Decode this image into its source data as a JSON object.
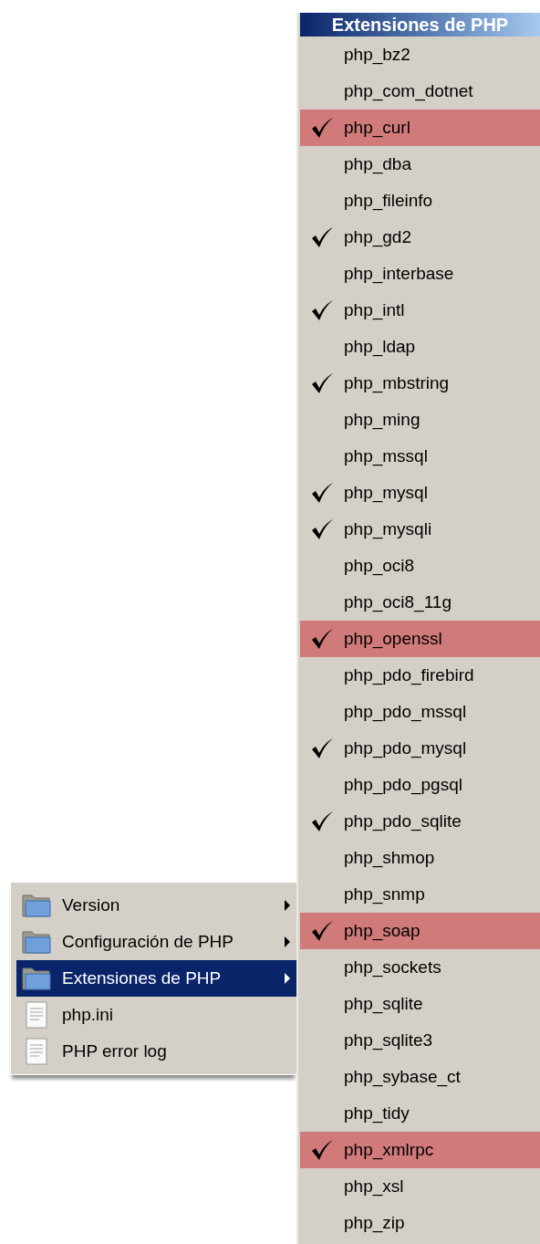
{
  "main_menu": {
    "items": [
      {
        "kind": "folder",
        "label": "Version",
        "has_submenu": true,
        "selected": false
      },
      {
        "kind": "folder",
        "label": "Configuración de PHP",
        "has_submenu": true,
        "selected": false
      },
      {
        "kind": "folder",
        "label": "Extensiones de PHP",
        "has_submenu": true,
        "selected": true
      },
      {
        "kind": "file",
        "label": "php.ini",
        "has_submenu": false,
        "selected": false
      },
      {
        "kind": "file",
        "label": "PHP error log",
        "has_submenu": false,
        "selected": false
      }
    ]
  },
  "submenu": {
    "title": "Extensiones de PHP",
    "items": [
      {
        "label": "php_bz2",
        "checked": false,
        "highlighted": false
      },
      {
        "label": "php_com_dotnet",
        "checked": false,
        "highlighted": false
      },
      {
        "label": "php_curl",
        "checked": true,
        "highlighted": true
      },
      {
        "label": "php_dba",
        "checked": false,
        "highlighted": false
      },
      {
        "label": "php_fileinfo",
        "checked": false,
        "highlighted": false
      },
      {
        "label": "php_gd2",
        "checked": true,
        "highlighted": false
      },
      {
        "label": "php_interbase",
        "checked": false,
        "highlighted": false
      },
      {
        "label": "php_intl",
        "checked": true,
        "highlighted": false
      },
      {
        "label": "php_ldap",
        "checked": false,
        "highlighted": false
      },
      {
        "label": "php_mbstring",
        "checked": true,
        "highlighted": false
      },
      {
        "label": "php_ming",
        "checked": false,
        "highlighted": false
      },
      {
        "label": "php_mssql",
        "checked": false,
        "highlighted": false
      },
      {
        "label": "php_mysql",
        "checked": true,
        "highlighted": false
      },
      {
        "label": "php_mysqli",
        "checked": true,
        "highlighted": false
      },
      {
        "label": "php_oci8",
        "checked": false,
        "highlighted": false
      },
      {
        "label": "php_oci8_11g",
        "checked": false,
        "highlighted": false
      },
      {
        "label": "php_openssl",
        "checked": true,
        "highlighted": true
      },
      {
        "label": "php_pdo_firebird",
        "checked": false,
        "highlighted": false
      },
      {
        "label": "php_pdo_mssql",
        "checked": false,
        "highlighted": false
      },
      {
        "label": "php_pdo_mysql",
        "checked": true,
        "highlighted": false
      },
      {
        "label": "php_pdo_pgsql",
        "checked": false,
        "highlighted": false
      },
      {
        "label": "php_pdo_sqlite",
        "checked": true,
        "highlighted": false
      },
      {
        "label": "php_shmop",
        "checked": false,
        "highlighted": false
      },
      {
        "label": "php_snmp",
        "checked": false,
        "highlighted": false
      },
      {
        "label": "php_soap",
        "checked": true,
        "highlighted": true
      },
      {
        "label": "php_sockets",
        "checked": false,
        "highlighted": false
      },
      {
        "label": "php_sqlite",
        "checked": false,
        "highlighted": false
      },
      {
        "label": "php_sqlite3",
        "checked": false,
        "highlighted": false
      },
      {
        "label": "php_sybase_ct",
        "checked": false,
        "highlighted": false
      },
      {
        "label": "php_tidy",
        "checked": false,
        "highlighted": false
      },
      {
        "label": "php_xmlrpc",
        "checked": true,
        "highlighted": true
      },
      {
        "label": "php_xsl",
        "checked": false,
        "highlighted": false
      },
      {
        "label": "php_zip",
        "checked": false,
        "highlighted": false
      }
    ]
  }
}
